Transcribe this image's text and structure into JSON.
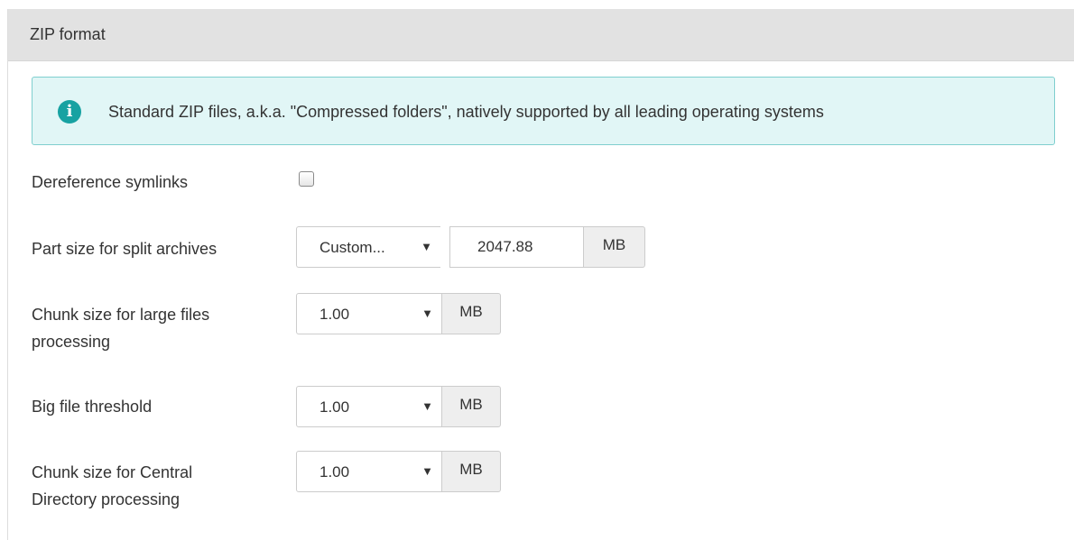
{
  "panel": {
    "title": "ZIP format"
  },
  "alert": {
    "icon": "info-icon",
    "text": "Standard ZIP files, a.k.a. \"Compressed folders\", natively supported by all leading operating systems"
  },
  "fields": {
    "dereference_symlinks": {
      "label": "Dereference symlinks",
      "checked": false
    },
    "part_size": {
      "label": "Part size for split archives",
      "select_value": "Custom...",
      "input_value": "2047.88",
      "unit": "MB"
    },
    "chunk_size": {
      "label_line1": "Chunk size for large files",
      "label_line2": "processing",
      "select_value": "1.00",
      "unit": "MB"
    },
    "big_file_threshold": {
      "label": "Big file threshold",
      "select_value": "1.00",
      "unit": "MB"
    },
    "cd_chunk_size": {
      "label_line1": "Chunk size for Central",
      "label_line2": "Directory processing",
      "select_value": "1.00",
      "unit": "MB"
    }
  },
  "glyphs": {
    "info": "i",
    "caret": "▼"
  }
}
